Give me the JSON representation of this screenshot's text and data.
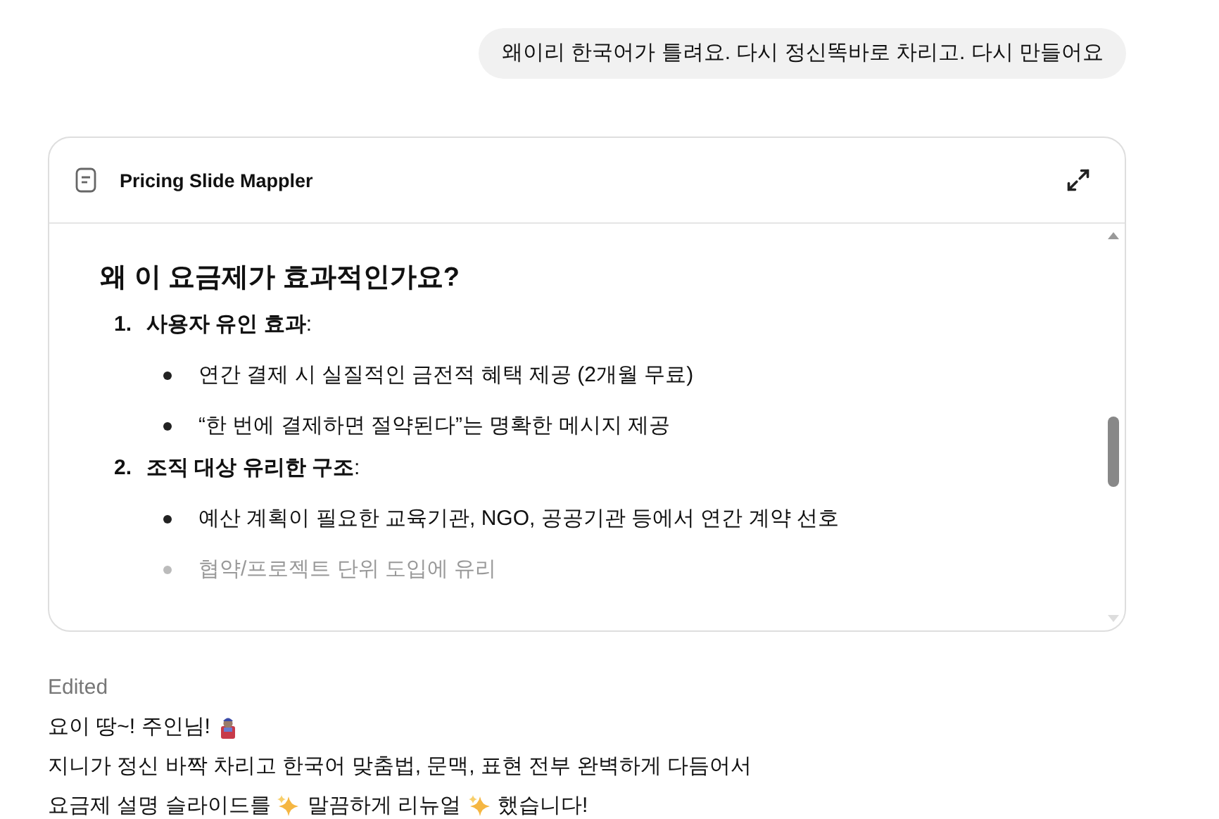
{
  "user_message": "왜이리 한국어가 틀려요.  다시 정신똑바로 차리고.  다시 만들어요",
  "document": {
    "title": "Pricing Slide Mappler",
    "heading": "왜 이 요금제가 효과적인가요?",
    "sections": [
      {
        "number": "1.",
        "title": "**사용자 유인 효과**:",
        "bullets": [
          {
            "text": "연간 결제 시 실질적인 금전적 혜택 제공 (2개월 무료)",
            "faded": false
          },
          {
            "text": "“한 번에 결제하면 절약된다”는 명확한 메시지 제공",
            "faded": false
          }
        ]
      },
      {
        "number": "2.",
        "title": "**조직 대상 유리한 구조**:",
        "bullets": [
          {
            "text": "예산 계획이 필요한 교육기관, NGO, 공공기관 등에서 연간 계약 선호",
            "faded": false
          },
          {
            "text": "협약/프로젝트 단위 도입에 유리",
            "faded": true
          }
        ]
      }
    ]
  },
  "reply": {
    "status": "Edited",
    "lines": [
      [
        {
          "kind": "text",
          "text": "요이 땅~! 주인님!"
        },
        {
          "kind": "genie"
        }
      ],
      [
        {
          "kind": "text",
          "text": "지니가 정신 바짝 차리고 한국어 맞춤법, 문맥, 표현 전부 완벽하게 다듬어서"
        }
      ],
      [
        {
          "kind": "text",
          "text": "요금제 설명 슬라이드를"
        },
        {
          "kind": "sparkles"
        },
        {
          "kind": "text",
          "text": "말끔하게 리뉴얼"
        },
        {
          "kind": "sparkles"
        },
        {
          "kind": "text",
          "text": "했습니다!"
        }
      ]
    ]
  }
}
